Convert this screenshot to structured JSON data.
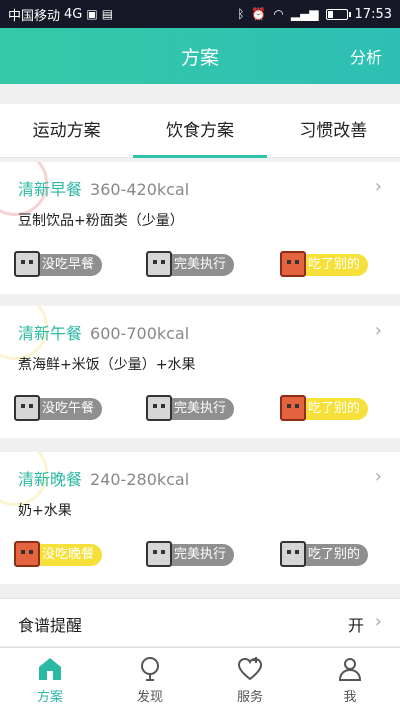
{
  "status_bar": {
    "carrier": "中国移动",
    "network": "4G",
    "time": "17:53",
    "icons": [
      "photo-icon",
      "sim-icon",
      "bluetooth-icon",
      "alarm-icon",
      "wifi-icon",
      "signal-icon",
      "battery-icon"
    ],
    "battery_level": 0.25
  },
  "header": {
    "title": "方案",
    "right_link": "分析"
  },
  "tabs": [
    {
      "label": "运动方案",
      "active": false
    },
    {
      "label": "饮食方案",
      "active": true
    },
    {
      "label": "习惯改善",
      "active": false
    }
  ],
  "meals": [
    {
      "name": "清新早餐",
      "kcal": "360-420kcal",
      "desc": "豆制饮品+粉面类（少量）",
      "actions": [
        "没吃早餐",
        "完美执行",
        "吃了别的"
      ],
      "highlight_index": 2
    },
    {
      "name": "清新午餐",
      "kcal": "600-700kcal",
      "desc": "煮海鲜+米饭（少量）+水果",
      "actions": [
        "没吃午餐",
        "完美执行",
        "吃了别的"
      ],
      "highlight_index": 2
    },
    {
      "name": "清新晚餐",
      "kcal": "240-280kcal",
      "desc": "奶+水果",
      "actions": [
        "没吃晚餐",
        "完美执行",
        "吃了别的"
      ],
      "highlight_index": 0
    }
  ],
  "reminder": {
    "label": "食谱提醒",
    "value": "开"
  },
  "bottom_nav": [
    {
      "label": "方案",
      "icon": "house-icon",
      "active": true
    },
    {
      "label": "发现",
      "icon": "balloon-icon",
      "active": false
    },
    {
      "label": "服务",
      "icon": "heart-plus-icon",
      "active": false
    },
    {
      "label": "我",
      "icon": "user-icon",
      "active": false
    }
  ],
  "colors": {
    "accent": "#2ab9a2",
    "highlight": "#f7e03a",
    "neutral_pill": "#8f8f8f"
  }
}
